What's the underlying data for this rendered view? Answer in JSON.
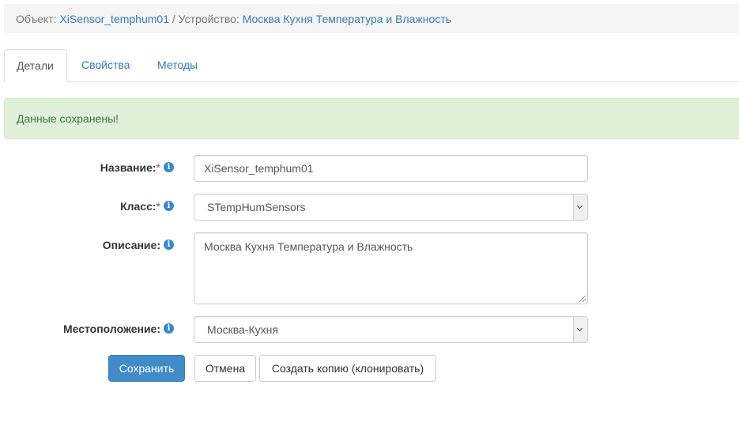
{
  "breadcrumb": {
    "object_label": "Объект:",
    "object_link": "XiSensor_temphum01",
    "separator": "/",
    "device_label": "Устройство:",
    "device_link": "Москва Кухня Температура и Влажность"
  },
  "tabs": [
    {
      "label": "Детали",
      "active": true
    },
    {
      "label": "Свойства",
      "active": false
    },
    {
      "label": "Методы",
      "active": false
    }
  ],
  "alert": {
    "text": "Данные сохранены!"
  },
  "form": {
    "name": {
      "label": "Название:",
      "required_mark": "*",
      "value": "XiSensor_temphum01"
    },
    "class": {
      "label": "Класс:",
      "required_mark": "*",
      "value": "STempHumSensors"
    },
    "description": {
      "label": "Описание:",
      "value": "Москва Кухня Температура и Влажность"
    },
    "location": {
      "label": "Местоположение:",
      "value": "Москва-Кухня"
    },
    "info_glyph": "i"
  },
  "buttons": {
    "save": "Сохранить",
    "cancel": "Отмена",
    "clone": "Создать копию (клонировать)"
  },
  "colors": {
    "link": "#337ab7",
    "alert_bg": "#dff0d8",
    "alert_text": "#3c763d",
    "primary": "#428bca",
    "required": "#a94442"
  },
  "icons": [
    "info-icon",
    "chevron-down-icon",
    "resize-grip-icon"
  ]
}
